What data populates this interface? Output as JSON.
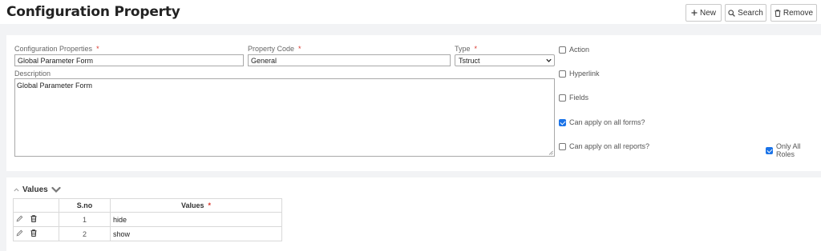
{
  "header": {
    "title": "Configuration Property",
    "buttons": {
      "new": "New",
      "search": "Search",
      "remove": "Remove"
    }
  },
  "form": {
    "config_properties": {
      "label": "Configuration Properties",
      "required": "*",
      "value": "Global Parameter Form"
    },
    "property_code": {
      "label": "Property Code",
      "required": "*",
      "value": "General"
    },
    "type": {
      "label": "Type",
      "required": "*",
      "selected": "Tstruct"
    },
    "description": {
      "label": "Description",
      "value": "Global Parameter Form"
    },
    "checkboxes": [
      {
        "label": "Action",
        "checked": false
      },
      {
        "label": "Hyperlink",
        "checked": false
      },
      {
        "label": "Fields",
        "checked": false
      },
      {
        "label": "Can apply on all forms?",
        "checked": true
      },
      {
        "label": "Can apply on all reports?",
        "checked": false
      },
      {
        "label": "Only All Roles",
        "checked": true
      }
    ]
  },
  "values_section": {
    "title": "Values",
    "columns": {
      "sno": "S.no",
      "values": "Values",
      "required": "*"
    },
    "rows": [
      {
        "sno": "1",
        "value": "hide"
      },
      {
        "sno": "2",
        "value": "show"
      }
    ]
  },
  "icons": [
    "plus-icon",
    "search-icon",
    "trash-icon",
    "chevron-down-icon",
    "chevron-up-icon",
    "pencil-icon",
    "resize-grip-icon"
  ],
  "colors": {
    "accent": "#1a73e8",
    "required": "#d9362b",
    "background": "#f2f3f5"
  }
}
